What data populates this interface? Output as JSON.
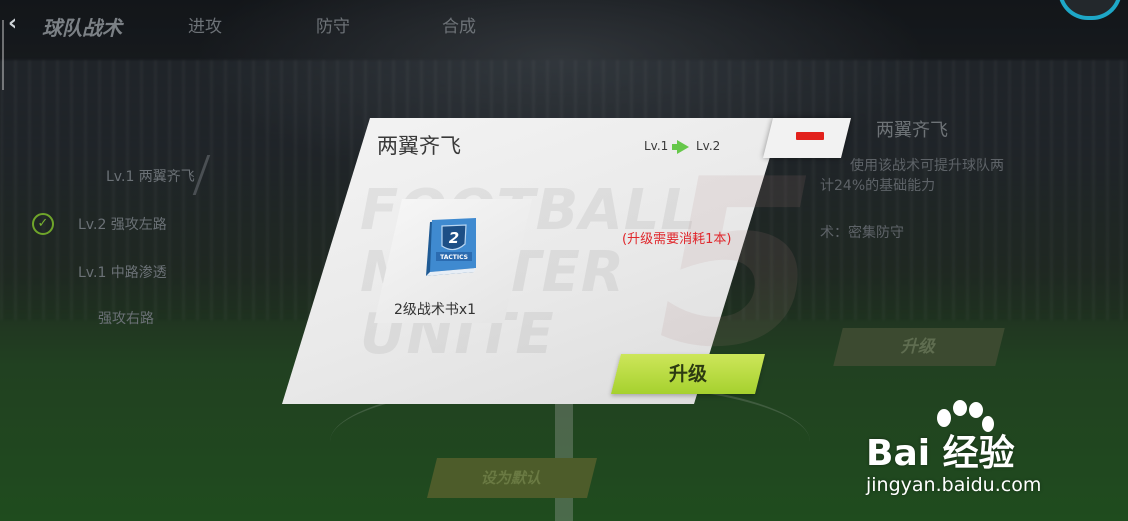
{
  "header": {
    "back_icon": "chevron-left-icon",
    "title": "球队战术",
    "tabs": [
      "进攻",
      "防守",
      "合成"
    ]
  },
  "background_list": {
    "items": [
      "Lv.1 两翼齐飞",
      "Lv.2 强攻左路",
      "Lv.1 中路渗透",
      "强攻右路"
    ]
  },
  "background_detail": {
    "title": "两翼齐飞",
    "desc": "使用该战术可提升球队两",
    "desc_cont": "计24%的基础能力",
    "counter": "术：密集防守",
    "upgrade": "升级"
  },
  "background_bottom_button": "设为默认",
  "modal": {
    "title": "两翼齐飞",
    "level_from": "Lv.1",
    "level_to": "Lv.2",
    "close_icon": "minus-icon",
    "item": {
      "icon": "tactics-book-icon",
      "book_number": "2",
      "book_word": "TACTICS",
      "label": "2级战术书x1"
    },
    "cost_text": "(升级需要消耗1本)",
    "upgrade_button": "升级",
    "bg_text": "FOOTBALL\nMASTER\nUNITE",
    "bg_number": "5"
  },
  "watermark": {
    "logo": "Bai 经验",
    "url": "jingyan.baidu.com"
  },
  "colors": {
    "accent_green": "#a6d12e",
    "close_red": "#e2211c",
    "cost_red": "#e0262b",
    "ring_cyan": "#1ea7c7"
  }
}
